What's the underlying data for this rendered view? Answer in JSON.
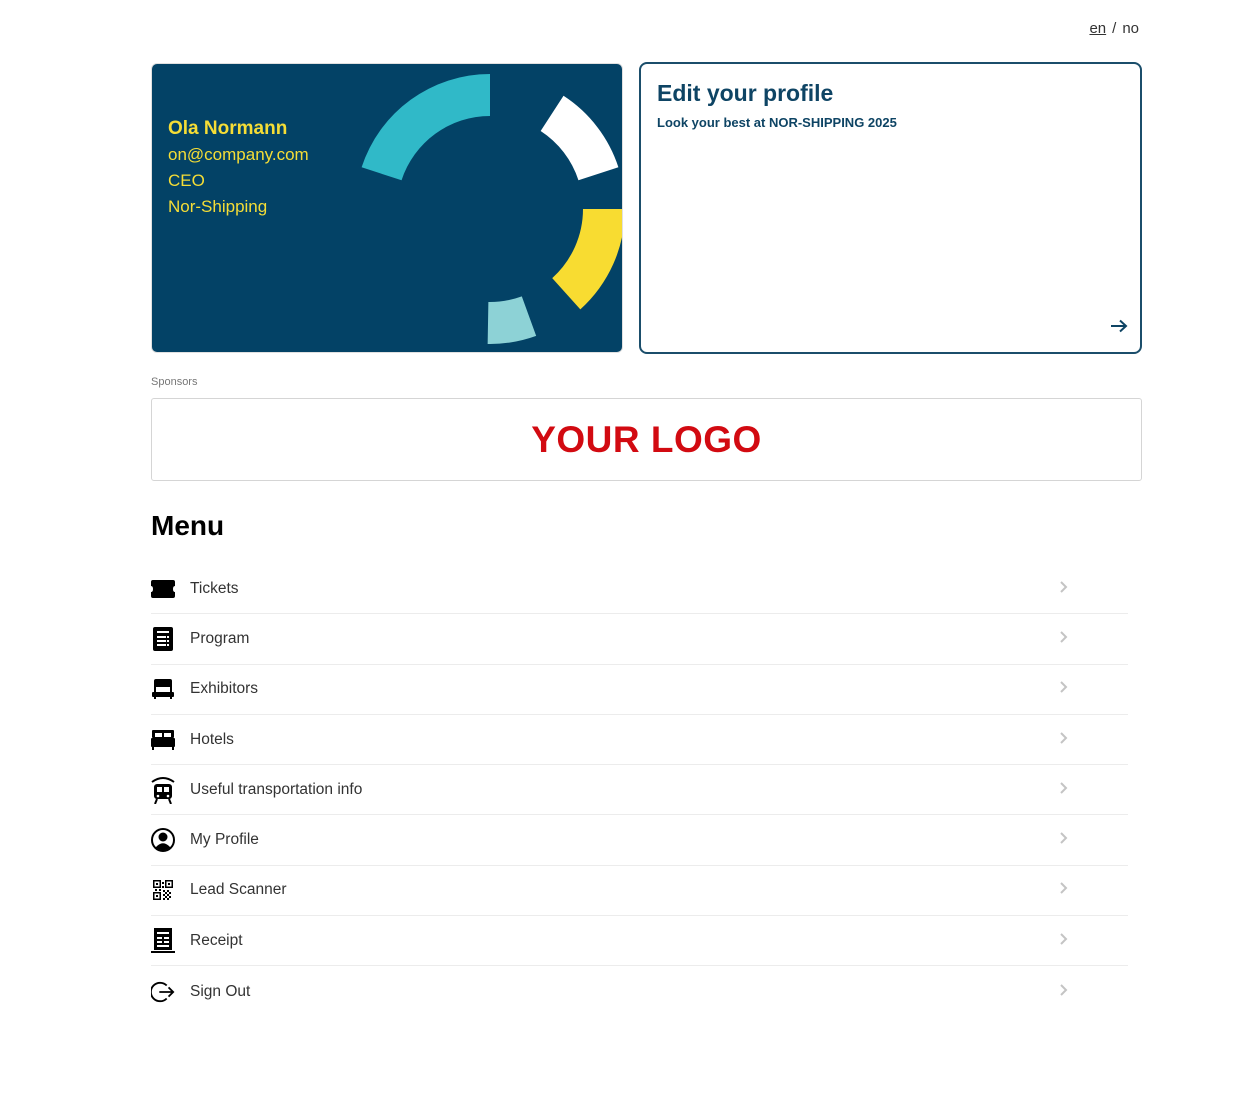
{
  "language": {
    "current": "en",
    "separator": "/",
    "other": "no"
  },
  "badge": {
    "name": "Ola Normann",
    "email": "on@company.com",
    "title": "CEO",
    "company": "Nor-Shipping",
    "colors": {
      "background": "#034266",
      "text": "#f5dd36",
      "teal": "#30b9c8",
      "white": "#ffffff",
      "yellow": "#f8dc31",
      "light_teal": "#8dd2d6"
    }
  },
  "edit_profile": {
    "title": "Edit your profile",
    "subtitle": "Look your best at NOR-SHIPPING 2025",
    "arrow_icon": "arrow-right-icon"
  },
  "sponsors": {
    "label": "Sponsors",
    "logo_text": "YOUR LOGO"
  },
  "menu": {
    "title": "Menu",
    "items": [
      {
        "label": "Tickets",
        "icon": "ticket-icon"
      },
      {
        "label": "Program",
        "icon": "program-icon"
      },
      {
        "label": "Exhibitors",
        "icon": "booth-icon"
      },
      {
        "label": "Hotels",
        "icon": "bed-icon"
      },
      {
        "label": "Useful transportation info",
        "icon": "train-icon"
      },
      {
        "label": "My Profile",
        "icon": "user-circle-icon"
      },
      {
        "label": "Lead Scanner",
        "icon": "qr-code-icon"
      },
      {
        "label": "Receipt",
        "icon": "receipt-icon"
      },
      {
        "label": "Sign Out",
        "icon": "sign-out-icon"
      }
    ]
  }
}
